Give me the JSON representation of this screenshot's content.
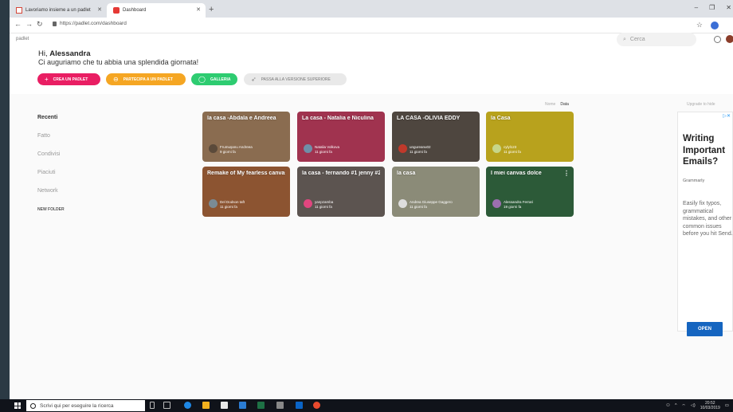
{
  "browser": {
    "tabs": [
      {
        "label": "Lavoriamo insieme a un padlet",
        "active": false
      },
      {
        "label": "Dashboard",
        "active": true
      }
    ],
    "url": "https://padlet.com/dashboard"
  },
  "header": {
    "brand": "padlet",
    "search_placeholder": "Cerca",
    "hi": "Hi,",
    "user": "Alessandra",
    "greeting": "Ci auguriamo che tu abbia una splendida giornata!"
  },
  "actions": {
    "create": "CREA UN PADLET",
    "join": "PARTECIPA A UN PADLET",
    "gallery": "GALLERIA",
    "upgrade": "PASSA ALLA VERSIONE SUPERIORE"
  },
  "sidebar": {
    "items": [
      "Recenti",
      "Fatto",
      "Condivisi",
      "Piaciuti",
      "Network"
    ],
    "new_folder": "NEW FOLDER"
  },
  "sort": {
    "name": "Nome",
    "date": "Data"
  },
  "cards": [
    {
      "title": "la casa -Abdala e Andreea",
      "user": "Frumuşanu Andreea",
      "time": "9 giorni fa",
      "bg": "#8a6c50"
    },
    {
      "title": "La casa - Natalia e Niculina",
      "user": "Natalia Volkova",
      "time": "11 giorni fa",
      "bg": "#a0334f"
    },
    {
      "title": "LA CASA -OLIVIA EDDY",
      "user": "ungureanu02",
      "time": "11 giorni fa",
      "bg": "#4e463f"
    },
    {
      "title": "la Casa",
      "user": "cylyl123",
      "time": "11 giorni fa",
      "bg": "#b8a21d"
    },
    {
      "title": "Remake of My fearless canvas",
      "user": "Del Dodson taft",
      "time": "11 giorni fa",
      "bg": "#8c5431"
    },
    {
      "title": "la casa - fernando #1 jenny #2",
      "user": "yanpzamba",
      "time": "11 giorni fa",
      "bg": "#5c5450"
    },
    {
      "title": "la casa",
      "user": "Andrea Giuseppe Gaggero",
      "time": "11 giorni fa",
      "bg": "#8b8b78"
    },
    {
      "title": "I miei canvas dolce",
      "user": "Alessandra Ferrari",
      "time": "19 giorni fa",
      "bg": "#2c5a38"
    }
  ],
  "ad": {
    "upgrade_to_hide": "Upgrade to hide",
    "headline": "Writing Important Emails?",
    "brand": "Grammarly",
    "description": "Easily fix typos, grammatical mistakes, and other common issues before you hit Send.",
    "cta": "OPEN"
  },
  "taskbar": {
    "search_placeholder": "Scrivi qui per eseguire la ricerca",
    "time": "20:52",
    "date": "10/03/2019"
  }
}
